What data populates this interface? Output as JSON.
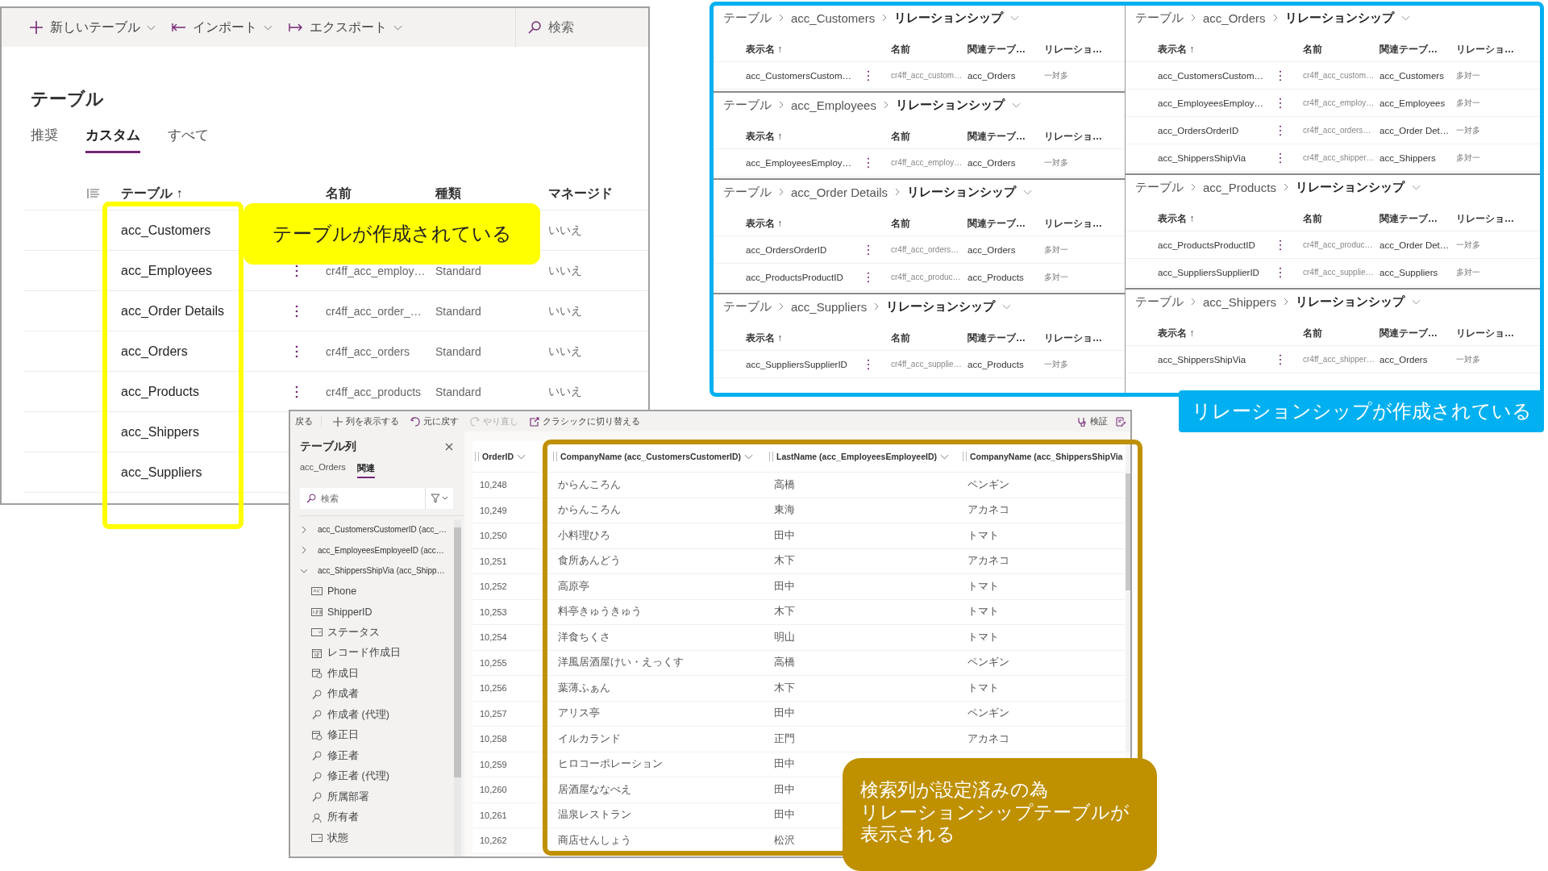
{
  "tables_window": {
    "toolbar": [
      {
        "kind": "new",
        "label": "新しいテーブル"
      },
      {
        "kind": "import",
        "label": "インポート"
      },
      {
        "kind": "export",
        "label": "エクスポート"
      }
    ],
    "search": {
      "placeholder": "検索"
    },
    "title": "テーブル",
    "tabs": [
      {
        "label": "推奨",
        "selected": false
      },
      {
        "label": "カスタム",
        "selected": true
      },
      {
        "label": "すべて",
        "selected": false
      }
    ],
    "columns": [
      "テーブル ↑",
      "名前",
      "種類",
      "マネージド"
    ],
    "rows": [
      {
        "display_name": "acc_Customers",
        "managed": "いいえ"
      },
      {
        "display_name": "acc_Employees",
        "name": "cr4ff_acc_employ…",
        "type": "Standard",
        "managed": "いいえ"
      },
      {
        "display_name": "acc_Order Details",
        "name": "cr4ff_acc_order_…",
        "type": "Standard",
        "managed": "いいえ"
      },
      {
        "display_name": "acc_Orders",
        "name": "cr4ff_acc_orders",
        "type": "Standard",
        "managed": "いいえ"
      },
      {
        "display_name": "acc_Products",
        "name": "cr4ff_acc_products",
        "type": "Standard",
        "managed": "いいえ"
      },
      {
        "display_name": "acc_Shippers"
      },
      {
        "display_name": "acc_Suppliers"
      }
    ],
    "callout": "テーブルが作成されている"
  },
  "relationships": {
    "left_column": [
      {
        "root": "テーブル",
        "table": "acc_Customers",
        "page": "リレーションシップ",
        "columns": [
          "表示名 ↑",
          "名前",
          "関連テーブ…",
          "リレーショ…"
        ],
        "rows": [
          [
            "acc_CustomersCustom…",
            "cr4ff_acc_custom…",
            "acc_Orders",
            "一対多"
          ]
        ]
      },
      {
        "root": "テーブル",
        "table": "acc_Employees",
        "page": "リレーションシップ",
        "columns": [
          "表示名 ↑",
          "名前",
          "関連テーブ…",
          "リレーショ…"
        ],
        "rows": [
          [
            "acc_EmployeesEmploy…",
            "cr4ff_acc_employ…",
            "acc_Orders",
            "一対多"
          ]
        ]
      },
      {
        "root": "テーブル",
        "table": "acc_Order Details",
        "page": "リレーションシップ",
        "columns": [
          "表示名 ↑",
          "名前",
          "関連テーブ…",
          "リレーショ…"
        ],
        "rows": [
          [
            "acc_OrdersOrderID",
            "cr4ff_acc_orders…",
            "acc_Orders",
            "多対一"
          ],
          [
            "acc_ProductsProductID",
            "cr4ff_acc_produc…",
            "acc_Products",
            "多対一"
          ]
        ]
      },
      {
        "root": "テーブル",
        "table": "acc_Suppliers",
        "page": "リレーションシップ",
        "columns": [
          "表示名 ↑",
          "名前",
          "関連テーブ…",
          "リレーショ…"
        ],
        "rows": [
          [
            "acc_SuppliersSupplierID",
            "cr4ff_acc_supplie…",
            "acc_Products",
            "一対多"
          ]
        ]
      }
    ],
    "right_column": [
      {
        "root": "テーブル",
        "table": "acc_Orders",
        "page": "リレーションシップ",
        "columns": [
          "表示名 ↑",
          "名前",
          "関連テーブ…",
          "リレーショ…"
        ],
        "rows": [
          [
            "acc_CustomersCustom…",
            "cr4ff_acc_custom…",
            "acc_Customers",
            "多対一"
          ],
          [
            "acc_EmployeesEmploy…",
            "cr4ff_acc_employ…",
            "acc_Employees",
            "多対一"
          ],
          [
            "acc_OrdersOrderID",
            "cr4ff_acc_orders…",
            "acc_Order Det…",
            "一対多"
          ],
          [
            "acc_ShippersShipVia",
            "cr4ff_acc_shipper…",
            "acc_Shippers",
            "多対一"
          ]
        ]
      },
      {
        "root": "テーブル",
        "table": "acc_Products",
        "page": "リレーションシップ",
        "columns": [
          "表示名 ↑",
          "名前",
          "関連テーブ…",
          "リレーショ…"
        ],
        "rows": [
          [
            "acc_ProductsProductID",
            "cr4ff_acc_produc…",
            "acc_Order Det…",
            "一対多"
          ],
          [
            "acc_SuppliersSupplierID",
            "cr4ff_acc_supplie…",
            "acc_Suppliers",
            "多対一"
          ]
        ]
      },
      {
        "root": "テーブル",
        "table": "acc_Shippers",
        "page": "リレーションシップ",
        "columns": [
          "表示名 ↑",
          "名前",
          "関連テーブ…",
          "リレーショ…"
        ],
        "rows": [
          [
            "acc_ShippersShipVia",
            "cr4ff_acc_shipper…",
            "acc_Orders",
            "一対多"
          ]
        ]
      }
    ],
    "callout": "リレーションシップが作成されている"
  },
  "designer_window": {
    "toolbar": [
      {
        "kind": "back",
        "label": "戻る",
        "disabled": false
      },
      {
        "kind": "show_columns",
        "label": "列を表示する",
        "disabled": false
      },
      {
        "kind": "undo",
        "label": "元に戻す",
        "disabled": false
      },
      {
        "kind": "redo",
        "label": "やり直し",
        "disabled": true
      },
      {
        "kind": "classic",
        "label": "クラシックに切り替える",
        "disabled": false
      }
    ],
    "toolbar_right": [
      {
        "kind": "check",
        "label": "検証"
      },
      {
        "kind": "edit"
      }
    ],
    "side_pane": {
      "title": "テーブル列",
      "tabs": [
        {
          "label": "acc_Orders",
          "selected": false
        },
        {
          "label": "関連",
          "selected": true
        }
      ],
      "search": {
        "placeholder": "検索"
      },
      "tree": [
        {
          "label": "acc_CustomersCustomerID (acc_…",
          "expanded": false
        },
        {
          "label": "acc_EmployeesEmployeeID (acc…",
          "expanded": false
        },
        {
          "label": "acc_ShippersShipVia (acc_Shipp…",
          "expanded": true,
          "children": [
            {
              "kind": "text",
              "label": "Phone"
            },
            {
              "kind": "number",
              "label": "ShipperID"
            },
            {
              "kind": "choice",
              "label": "ステータス"
            },
            {
              "kind": "date",
              "label": "レコード作成日"
            },
            {
              "kind": "datetime",
              "label": "作成日"
            },
            {
              "kind": "lookup",
              "label": "作成者"
            },
            {
              "kind": "lookup",
              "label": "作成者 (代理)"
            },
            {
              "kind": "datetime",
              "label": "修正日"
            },
            {
              "kind": "lookup",
              "label": "修正者"
            },
            {
              "kind": "lookup",
              "label": "修正者 (代理)"
            },
            {
              "kind": "lookup",
              "label": "所属部署"
            },
            {
              "kind": "owner",
              "label": "所有者"
            },
            {
              "kind": "choice",
              "label": "状態"
            }
          ]
        }
      ]
    },
    "grid": {
      "columns": [
        "OrderID",
        "CompanyName (acc_CustomersCustomerID)",
        "LastName (acc_EmployeesEmployeeID)",
        "CompanyName (acc_ShippersShipVia"
      ],
      "rows": [
        [
          "10,248",
          "からんころん",
          "高橋",
          "ペンギン"
        ],
        [
          "10,249",
          "からんころん",
          "東海",
          "アカネコ"
        ],
        [
          "10,250",
          "小料理ひろ",
          "田中",
          "トマト"
        ],
        [
          "10,251",
          "食所あんどう",
          "木下",
          "アカネコ"
        ],
        [
          "10,252",
          "高原亭",
          "田中",
          "トマト"
        ],
        [
          "10,253",
          "料亭きゅうきゅう",
          "木下",
          "トマト"
        ],
        [
          "10,254",
          "洋食ちくさ",
          "明山",
          "トマト"
        ],
        [
          "10,255",
          "洋風居酒屋けい・えっくす",
          "高橋",
          "ペンギン"
        ],
        [
          "10,256",
          "葉薄ふぁん",
          "木下",
          "トマト"
        ],
        [
          "10,257",
          "アリス亭",
          "田中",
          "ペンギン"
        ],
        [
          "10,258",
          "イルカランド",
          "正門",
          "アカネコ"
        ],
        [
          "10,259",
          "ヒロコーポレーション",
          "田中"
        ],
        [
          "10,260",
          "居酒屋ななべえ",
          "田中"
        ],
        [
          "10,261",
          "温泉レストラン",
          "田中"
        ],
        [
          "10,262",
          "商店せんしょう",
          "松沢"
        ]
      ]
    },
    "callout_lines": [
      "検索列が設定済みの為",
      "リレーションシップテーブルが",
      "表示される"
    ]
  }
}
